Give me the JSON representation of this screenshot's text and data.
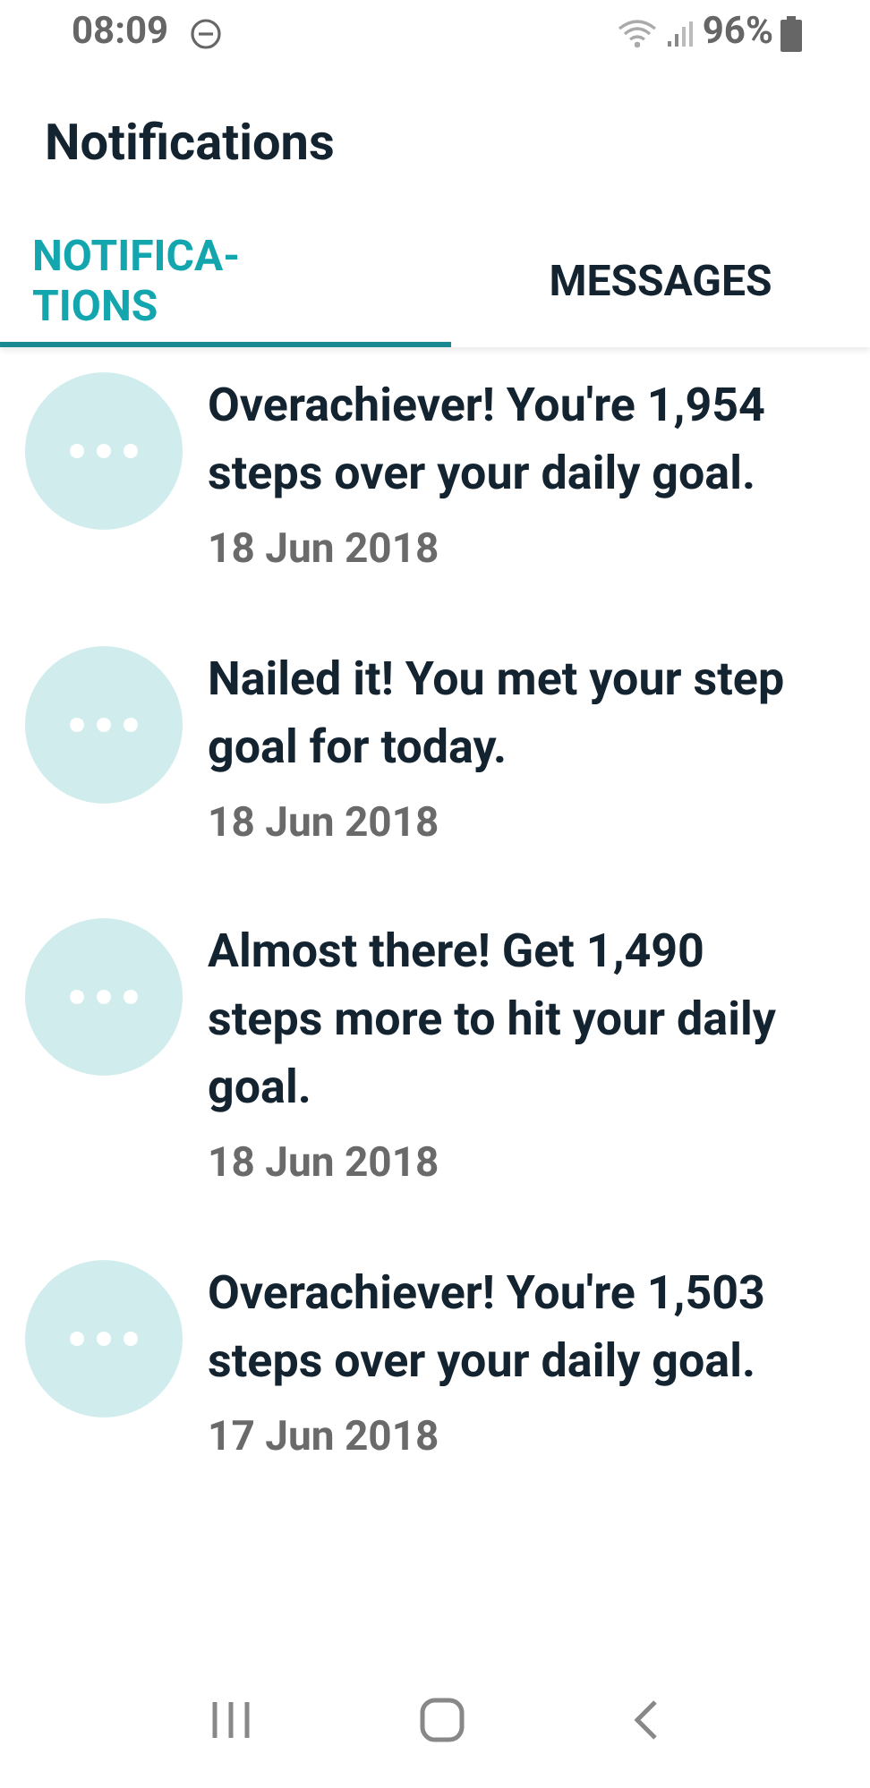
{
  "status_bar": {
    "time": "08:09",
    "battery": "96%"
  },
  "header": {
    "title": "Notifications"
  },
  "tabs": [
    {
      "label": "NOTIFICA-TIONS",
      "selected": true
    },
    {
      "label": "MESSAGES",
      "selected": false
    }
  ],
  "notifications": [
    {
      "text": "Overachiever! You're 1,954 steps over your daily goal.",
      "date": "18 Jun 2018"
    },
    {
      "text": "Nailed it! You met your step goal for today.",
      "date": "18 Jun 2018"
    },
    {
      "text": "Almost there! Get 1,490 steps more to hit your daily goal.",
      "date": "18 Jun 2018"
    },
    {
      "text": "Overachiever! You're 1,503 steps over your daily goal.",
      "date": "17 Jun 2018"
    }
  ]
}
